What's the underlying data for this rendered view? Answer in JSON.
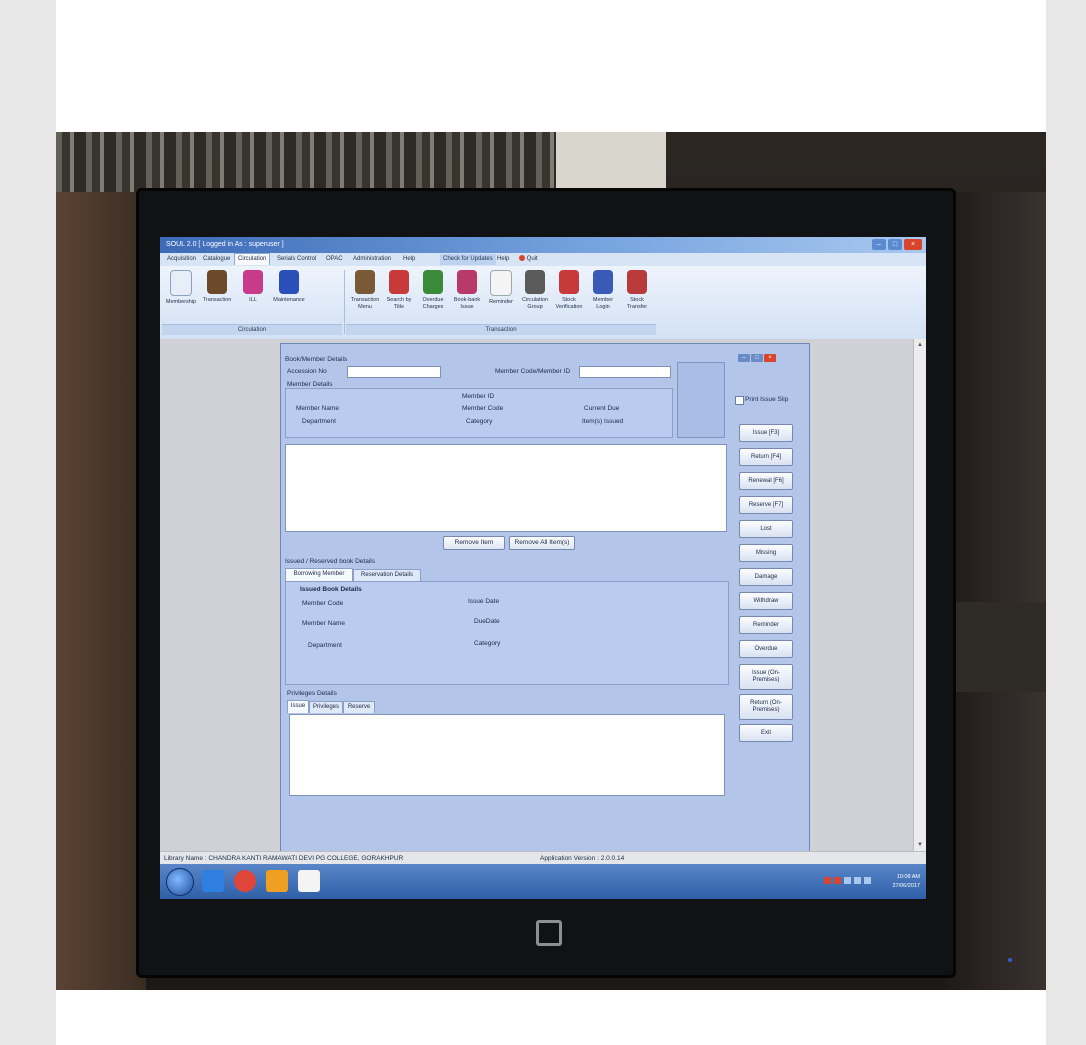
{
  "window": {
    "title": "SOUL 2.0 [ Logged in As : superuser ]",
    "controls": {
      "minimize": "–",
      "maximize": "□",
      "close": "×"
    }
  },
  "menu": {
    "items": [
      "Acquisition",
      "Catalogue",
      "Circulation",
      "Serials Control",
      "OPAC",
      "Administration",
      "Help",
      "Check for Updates",
      "Help",
      "Quit"
    ],
    "active_index": 2
  },
  "ribbon": {
    "circulation_buttons": [
      {
        "label": "Membership",
        "icon": "membership-icon",
        "color": "#e8eef8"
      },
      {
        "label": "Transaction",
        "icon": "transaction-person-icon",
        "color": "#6b4a2a"
      },
      {
        "label": "ILL",
        "icon": "ill-icon",
        "color": "#c83a8a"
      },
      {
        "label": "Maintenance",
        "icon": "maintenance-book-icon",
        "color": "#2a4fb8"
      }
    ],
    "circulation_group_label": "Circulation",
    "transaction_buttons": [
      {
        "label": "Transaction Menu",
        "icon": "transaction-menu-icon",
        "color": "#7a5a36"
      },
      {
        "label": "Search by Title",
        "icon": "search-by-title-icon",
        "color": "#c83a3a"
      },
      {
        "label": "Overdue Charges",
        "icon": "overdue-charges-icon",
        "color": "#3a8a3a"
      },
      {
        "label": "Book-bank Issue",
        "icon": "book-bank-issue-icon",
        "color": "#b83a6a"
      },
      {
        "label": "Reminder",
        "icon": "reminder-icon",
        "color": "#f4f4f4"
      },
      {
        "label": "Circulation Group",
        "icon": "circulation-group-icon",
        "color": "#5a5a5a"
      },
      {
        "label": "Stock Verification",
        "icon": "stock-verification-icon",
        "color": "#c83a3a"
      },
      {
        "label": "Member Login",
        "icon": "member-login-icon",
        "color": "#3a5ab8"
      },
      {
        "label": "Stock Transfer",
        "icon": "stock-transfer-icon",
        "color": "#b83a3a"
      }
    ],
    "transaction_group_label": "Transaction"
  },
  "form": {
    "book_member_details": {
      "legend": "Book/Member Details",
      "accession_label": "Accession No",
      "accession_value": "",
      "member_code_label": "Member Code/Member ID",
      "member_code_value": ""
    },
    "member_details": {
      "legend": "Member Details",
      "member_id": "Member ID",
      "member_name": "Member Name",
      "member_code": "Member Code",
      "current_due": "Current Due",
      "department": "Department",
      "category": "Category",
      "items_issued": "Item(s) Issued"
    },
    "remove_item_label": "Remove Item",
    "remove_all_label": "Remove All Item(s)",
    "issued_reserved": {
      "legend": "Issued / Reserved book Details",
      "tabs": [
        "Borrowing Member",
        "Reservation Details"
      ],
      "issued_book_details": "Issued Book Details",
      "member_code": "Member Code",
      "issue_date": "Issue Date",
      "member_name": "Member Name",
      "due_date": "DueDate",
      "department": "Department",
      "category": "Category"
    },
    "privileges": {
      "legend": "Privileges Details",
      "tabs": [
        "Issue",
        "Privileges",
        "Reserve"
      ]
    }
  },
  "side_panel": {
    "print_issue_slip": "Print Issue Slip",
    "print_issue_slip_checked": false,
    "buttons": [
      "Issue [F3]",
      "Return [F4]",
      "Renewal [F6]",
      "Reserve [F7]",
      "Lost",
      "Missing",
      "Damage",
      "Withdraw",
      "Reminder",
      "Overdue",
      "Issue (On-Premises)",
      "Return (On-Premises)",
      "Exit"
    ]
  },
  "status": {
    "library_name": "Library Name : CHANDRA KANTI RAMAWATI DEVI PG COLLEGE, GORAKHPUR",
    "app_version": "Application Version : 2.0.0.14"
  },
  "taskbar": {
    "apps": [
      {
        "icon": "ie-icon",
        "color": "#2f7fe0"
      },
      {
        "icon": "chrome-icon",
        "color": "#e0453a"
      },
      {
        "icon": "media-player-icon",
        "color": "#f0a020"
      },
      {
        "icon": "soul-icon",
        "color": "#f4f4f4"
      }
    ],
    "time": "10:08 AM",
    "date": "27/06/2017"
  }
}
